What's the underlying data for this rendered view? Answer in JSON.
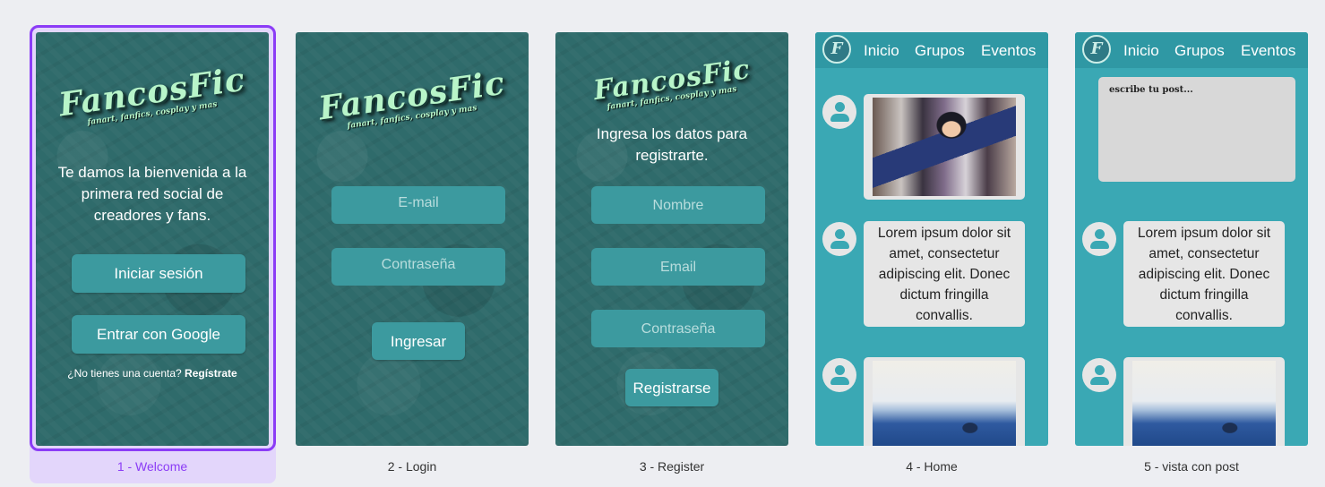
{
  "welcome": {
    "logo": {
      "title": "FancosFic",
      "tagline": "fanart, fanfics, cosplay y mas"
    },
    "message": [
      "Te damos la bienvenida a la",
      "primera red social de",
      "creadores y fans."
    ],
    "login_button": "Iniciar sesión",
    "google_button": "Entrar con Google",
    "no_account": "¿No tienes una cuenta?",
    "signup_link": "Regístrate"
  },
  "login": {
    "logo": {
      "title": "FancosFic",
      "tagline": "fanart, fanfics, cosplay y mas"
    },
    "email_placeholder": "E-mail",
    "password_placeholder": "Contraseña",
    "submit_button": "Ingresar"
  },
  "register": {
    "logo": {
      "title": "FancosFic",
      "tagline": "fanart, fanfics, cosplay y mas"
    },
    "message": [
      "Ingresa los datos para",
      "registrarte."
    ],
    "name_placeholder": "Nombre",
    "email_placeholder": "Email",
    "password_placeholder": "Contraseña",
    "submit_button": "Registrarse"
  },
  "nav": {
    "logo_letter": "F",
    "links": [
      "Inicio",
      "Grupos",
      "Eventos"
    ]
  },
  "post_text": [
    "Lorem ipsum dolor sit",
    "amet, consectetur",
    "adipiscing elit. Donec",
    "dictum fringilla",
    "convallis."
  ],
  "compose_placeholder": "escribe tu post...",
  "labels": [
    "1 - Welcome",
    "2 - Login",
    "3 - Register",
    "4 - Home",
    "5 - vista con post"
  ],
  "colors": {
    "accent": "#8b3cf6",
    "teal": "#3aa8b4",
    "card_bg": "#2f6b6b",
    "button": "#3c9a9f"
  }
}
